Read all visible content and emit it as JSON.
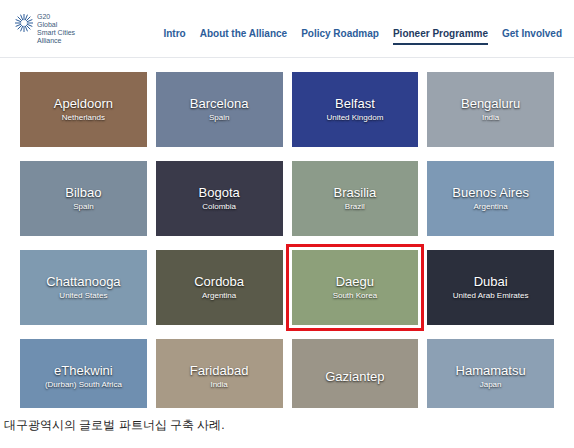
{
  "logo": {
    "lines": [
      "G20",
      "Global",
      "Smart Cities",
      "Alliance"
    ]
  },
  "nav": [
    {
      "label": "Intro",
      "selected": false
    },
    {
      "label": "About the Alliance",
      "selected": false
    },
    {
      "label": "Policy Roadmap",
      "selected": false
    },
    {
      "label": "Pioneer Programme",
      "selected": true
    },
    {
      "label": "Get Involved",
      "selected": false
    }
  ],
  "cards": [
    {
      "city": "Apeldoorn",
      "country": "Netherlands",
      "selected": false
    },
    {
      "city": "Barcelona",
      "country": "Spain",
      "selected": false
    },
    {
      "city": "Belfast",
      "country": "United Kingdom",
      "selected": false
    },
    {
      "city": "Bengaluru",
      "country": "India",
      "selected": false
    },
    {
      "city": "Bilbao",
      "country": "Spain",
      "selected": false
    },
    {
      "city": "Bogota",
      "country": "Colombia",
      "selected": false
    },
    {
      "city": "Brasilia",
      "country": "Brazil",
      "selected": false
    },
    {
      "city": "Buenos Aires",
      "country": "Argentina",
      "selected": false
    },
    {
      "city": "Chattanooga",
      "country": "United States",
      "selected": false
    },
    {
      "city": "Cordoba",
      "country": "Argentina",
      "selected": false
    },
    {
      "city": "Daegu",
      "country": "South Korea",
      "selected": true
    },
    {
      "city": "Dubai",
      "country": "United Arab Emirates",
      "selected": false
    },
    {
      "city": "eThekwini",
      "country": "(Durban) South Africa",
      "selected": false
    },
    {
      "city": "Faridabad",
      "country": "India",
      "selected": false
    },
    {
      "city": "Gaziantep",
      "selected": false
    },
    {
      "city": "Hamamatsu",
      "country": "Japan",
      "selected": false
    }
  ],
  "caption": "대구광역시의 글로벌 파트너십 구축 사례."
}
